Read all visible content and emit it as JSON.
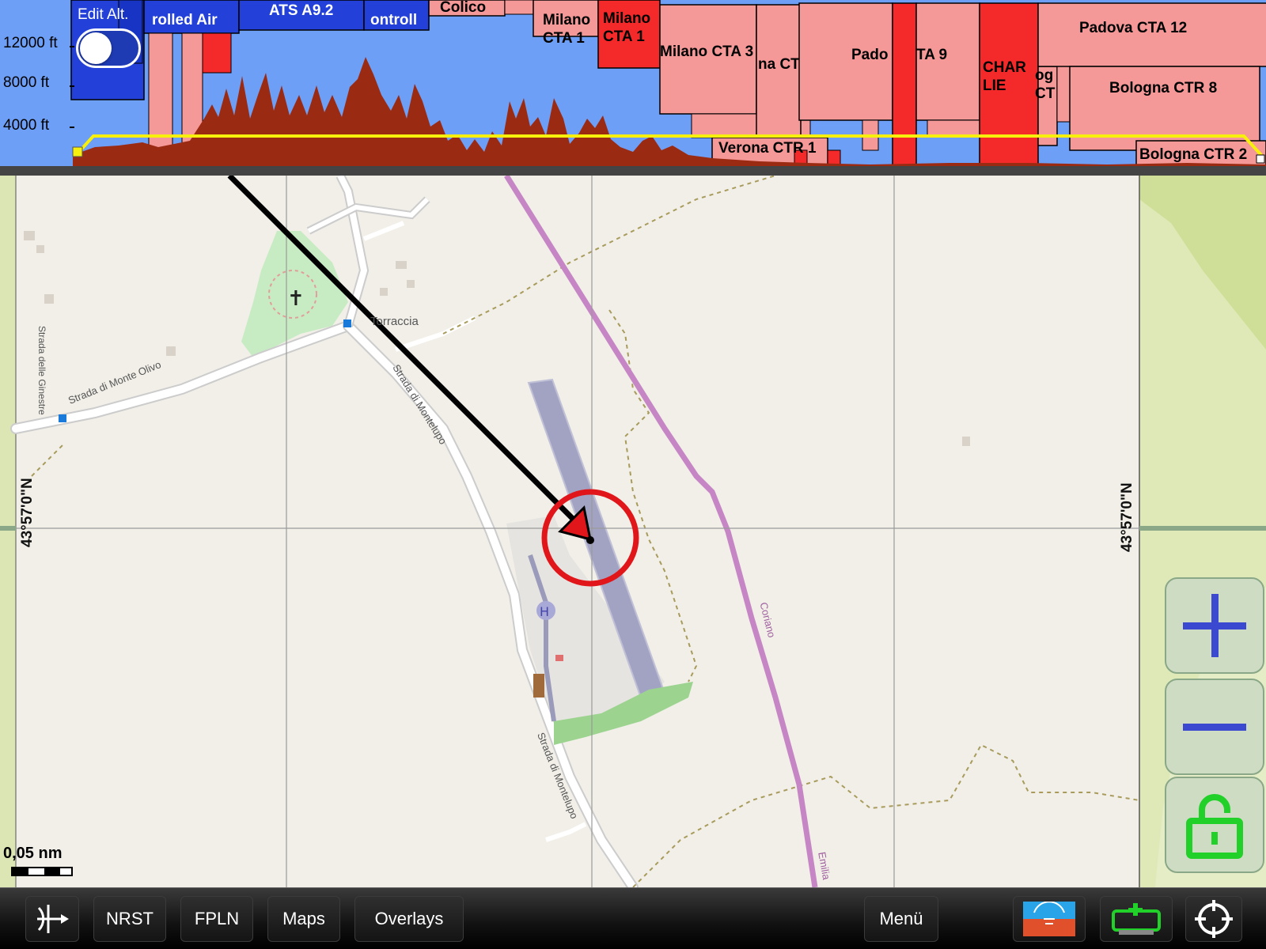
{
  "profile": {
    "edit_alt_label": "Edit Alt.",
    "edit_alt_toggle_on": false,
    "altitude_labels": [
      "12000 ft",
      "8000 ft",
      "4000 ft"
    ],
    "airspaces": [
      {
        "label": "Swiss Cont\nrolled Air",
        "visible_text": "rolled Air"
      },
      {
        "label": "ATS A9.2"
      },
      {
        "label": "ontroll"
      },
      {
        "label": "Colico"
      },
      {
        "label": "Milano\nCTA 1"
      },
      {
        "label": "Milano\nCTA 1",
        "color": "#f42a2a"
      },
      {
        "label": "Milano CTA 3"
      },
      {
        "label": "na CT"
      },
      {
        "label": "Pado"
      },
      {
        "label": "TA 9"
      },
      {
        "label": "CHAR\nLIE",
        "color": "#f42a2a"
      },
      {
        "label": "og\nCT"
      },
      {
        "label": "Padova CTA 12"
      },
      {
        "label": "Bologna CTR 8"
      },
      {
        "label": "Verona CTR 1"
      },
      {
        "label": "Bologna CTR 2"
      }
    ],
    "colors": {
      "background": "#6e9ff6",
      "controlled": "#f49898",
      "restricted": "#f42a2a",
      "swiss": "#2340d9",
      "terrain": "#9b2a12",
      "route": "#f7f00c"
    }
  },
  "map": {
    "place_labels": [
      "Torraccia",
      "Strada di Monte Olivo",
      "Strada delle Ginestre",
      "Strada di Montelupo",
      "Strada di Montelupo",
      "Coriano",
      "Emilia"
    ],
    "latitude_label": "43°57'0\"N",
    "scale_label": "0,05 nm",
    "lock_state": "unlocked"
  },
  "zoom": {
    "zoom_in_icon": "plus-icon",
    "zoom_out_icon": "minus-icon",
    "lock_icon": "lock-open-icon"
  },
  "toolbar": {
    "direct_to_icon": "direct-to-icon",
    "nrst_label": "NRST",
    "fpln_label": "FPLN",
    "maps_label": "Maps",
    "overlays_label": "Overlays",
    "menu_label": "Menü",
    "instrument_icon": "attitude-indicator-icon",
    "battery_icon": "device-status-icon",
    "center_icon": "crosshair-icon"
  }
}
